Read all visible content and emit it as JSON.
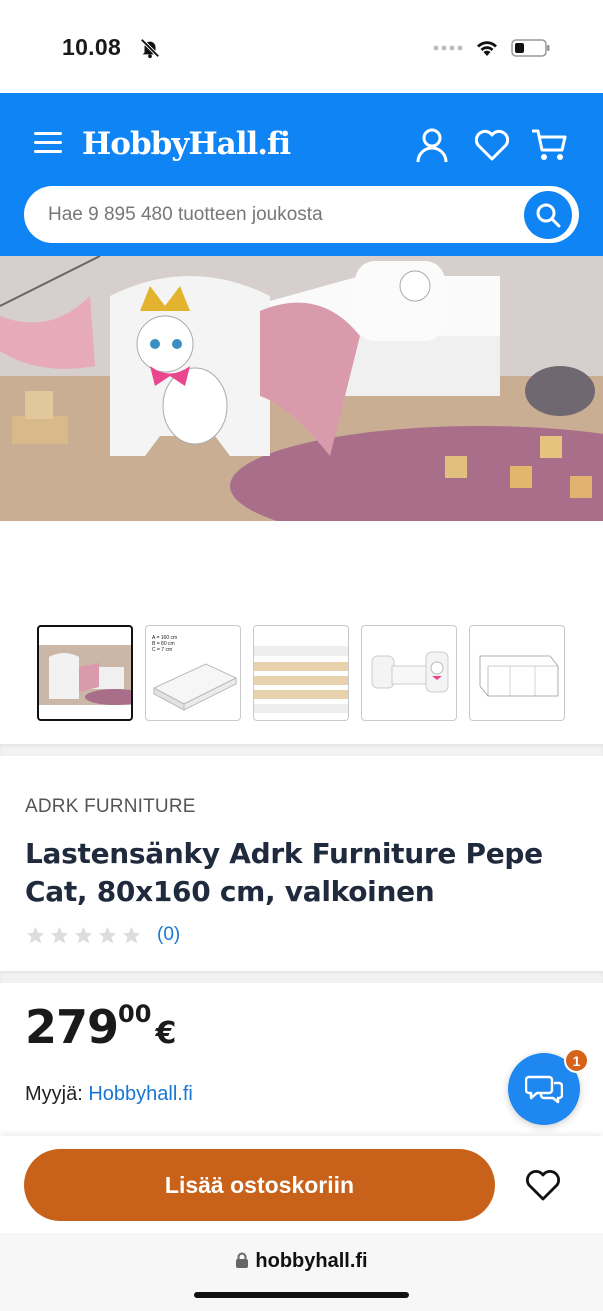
{
  "status_bar": {
    "time": "10.08"
  },
  "header": {
    "logo": "HobbyHall.fi",
    "search_placeholder": "Hae 9 895 480 tuotteen joukosta"
  },
  "product": {
    "brand": "ADRK FURNITURE",
    "title": "Lastensänky Adrk Furniture Pepe Cat, 80x160 cm, valkoinen",
    "rating_stars": 0,
    "review_count": "(0)",
    "price_int": "279",
    "price_dec": "00",
    "currency": "€",
    "seller_label": "Myyjä:",
    "seller_name": "Hobbyhall.fi"
  },
  "thumbnails": [
    {
      "name": "thumb-bed-room",
      "active": true
    },
    {
      "name": "thumb-mattress-dimensions",
      "active": false,
      "text": [
        "A = 160 cm",
        "B = 80 cm",
        "C = 7 cm"
      ]
    },
    {
      "name": "thumb-slats",
      "active": false
    },
    {
      "name": "thumb-bed-white",
      "active": false
    },
    {
      "name": "thumb-technical-drawing",
      "active": false
    }
  ],
  "chat": {
    "badge": "1"
  },
  "actions": {
    "add_to_cart": "Lisää ostoskoriin"
  },
  "browser": {
    "url": "hobbyhall.fi"
  },
  "colors": {
    "brand_blue": "#0f84f5",
    "cta_orange": "#c8621a",
    "link_blue": "#1976d2"
  }
}
